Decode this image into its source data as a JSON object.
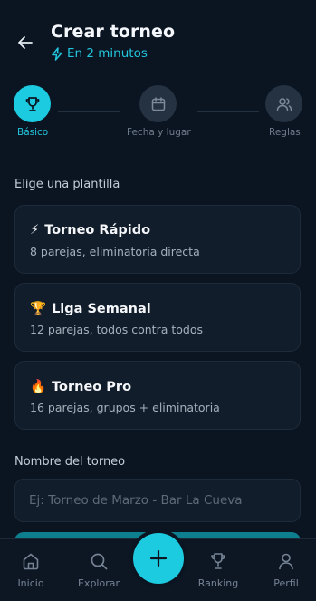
{
  "header": {
    "title": "Crear torneo",
    "subtitle": "En 2 minutos",
    "back_icon": "arrow-left-icon",
    "subtitle_icon": "lightning-icon"
  },
  "stepper": {
    "current_step": 1,
    "steps": [
      {
        "label": "Básico",
        "icon": "trophy-icon",
        "active": true
      },
      {
        "label": "Fecha y lugar",
        "icon": "calendar-icon",
        "active": false
      },
      {
        "label": "Reglas",
        "icon": "users-icon",
        "active": false
      }
    ]
  },
  "templates": {
    "section_label": "Elige una plantilla",
    "items": [
      {
        "emoji": "⚡",
        "title": "Torneo Rápido",
        "description": "8 parejas, eliminatoria directa"
      },
      {
        "emoji": "🏆",
        "title": "Liga Semanal",
        "description": "12 parejas, todos contra todos"
      },
      {
        "emoji": "🔥",
        "title": "Torneo Pro",
        "description": "16 parejas, grupos + eliminatoria"
      }
    ]
  },
  "name_field": {
    "label": "Nombre del torneo",
    "placeholder": "Ej: Torneo de Marzo - Bar La Cueva",
    "value": ""
  },
  "tabbar": {
    "items": [
      {
        "label": "Inicio",
        "icon": "home-icon"
      },
      {
        "label": "Explorar",
        "icon": "search-icon"
      },
      {
        "label": "Ranking",
        "icon": "trophy-icon"
      },
      {
        "label": "Perfil",
        "icon": "user-icon"
      }
    ],
    "fab_icon": "plus-icon"
  },
  "colors": {
    "background": "#0b1421",
    "card": "#121d2b",
    "accent": "#1ccbe0",
    "muted_text": "#758395"
  }
}
